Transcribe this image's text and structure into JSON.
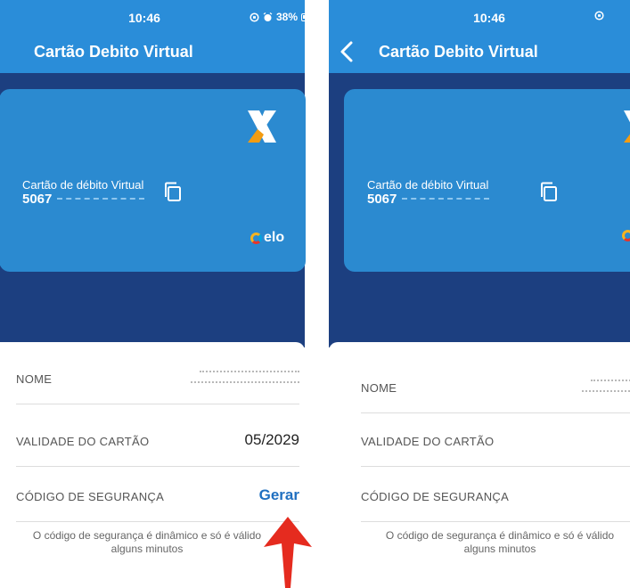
{
  "status_bar": {
    "time": "10:46",
    "battery": "38%"
  },
  "header": {
    "title": "Cartão Debito Virtual"
  },
  "card": {
    "label": "Cartão de débito Virtual",
    "number_prefix": "5067",
    "brand": "elo"
  },
  "details": {
    "name_label": "NOME",
    "validity_label": "VALIDADE DO CARTÃO",
    "validity_value": "05/2029",
    "security_label": "CÓDIGO DE SEGURANÇA",
    "generate_label": "Gerar",
    "footnote_line1": "O código de segurança é dinâmico e só é válido",
    "footnote_line2": "alguns minutos"
  },
  "colors": {
    "header": "#2a8dd9",
    "background_dark": "#1c3f80",
    "card": "#2b8ad0",
    "accent": "#1f6fc0",
    "arrow": "#e52b1f"
  },
  "icons": {
    "back": "chevron-left-icon",
    "copy": "copy-icon",
    "alarm": "alarm-icon",
    "logo": "caixa-x-logo"
  }
}
